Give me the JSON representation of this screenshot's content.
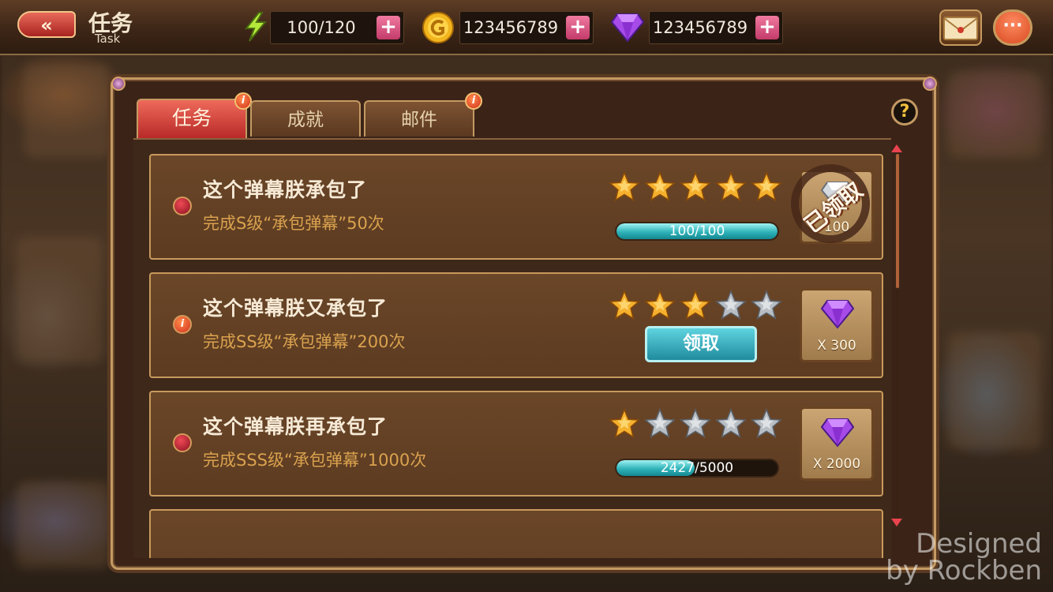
{
  "header": {
    "back_label": "«",
    "title": "任务",
    "subtitle": "Task",
    "energy": "100/120",
    "gold": "123456789",
    "gems": "123456789",
    "plus_label": "+",
    "chat_label": "···"
  },
  "tabs": [
    {
      "label": "任务",
      "active": true,
      "badge": "i"
    },
    {
      "label": "成就",
      "active": false
    },
    {
      "label": "邮件",
      "active": false,
      "badge": "i"
    }
  ],
  "help_label": "?",
  "tasks": [
    {
      "title": "这个弹幕朕承包了",
      "description": "完成S级“承包弹幕”50次",
      "stars_filled": 5,
      "stars_total": 5,
      "status": "claimed",
      "progress_text": "100/100",
      "progress": 1.0,
      "stamp": "已领取",
      "reward_qty": "100",
      "indicator": "dot"
    },
    {
      "title": "这个弹幕朕又承包了",
      "description": "完成SS级“承包弹幕”200次",
      "stars_filled": 3,
      "stars_total": 5,
      "status": "claimable",
      "claim_label": "领取",
      "reward_qty": "X 300",
      "indicator": "info",
      "indicator_label": "i"
    },
    {
      "title": "这个弹幕朕再承包了",
      "description": "完成SSS级“承包弹幕”1000次",
      "stars_filled": 1,
      "stars_total": 5,
      "status": "in_progress",
      "progress_text": "2427/5000",
      "progress": 0.4854,
      "reward_qty": "X 2000",
      "indicator": "dot"
    }
  ],
  "watermark": {
    "line1": "Designed",
    "line2": "by Rockben"
  },
  "colors": {
    "star_gold": "#f5b12e",
    "star_silver": "#b8bec4",
    "progress": "#2fb3b8",
    "accent_red": "#c12f2a"
  }
}
